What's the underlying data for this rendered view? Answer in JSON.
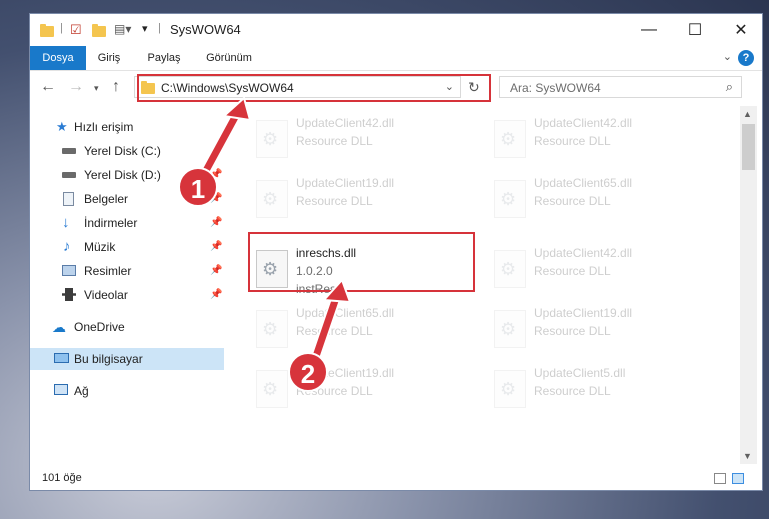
{
  "window": {
    "title": "SysWOW64",
    "controls": [
      "—",
      "☐",
      "✕"
    ]
  },
  "ribbon": {
    "tabs": [
      "Dosya",
      "Giriş",
      "Paylaş",
      "Görünüm"
    ],
    "help": "?"
  },
  "address": {
    "path": "C:\\Windows\\SysWOW64",
    "search_placeholder": "Ara: SysWOW64"
  },
  "sidebar": {
    "items": [
      {
        "label": "Hızlı erişim",
        "icon": "star-icon",
        "pinned": false
      },
      {
        "label": "Yerel Disk (C:)",
        "icon": "disk-icon",
        "pinned": true
      },
      {
        "label": "Yerel Disk (D:)",
        "icon": "disk-icon",
        "pinned": true
      },
      {
        "label": "Belgeler",
        "icon": "documents-icon",
        "pinned": true
      },
      {
        "label": "İndirmeler",
        "icon": "download-icon",
        "pinned": true
      },
      {
        "label": "Müzik",
        "icon": "music-icon",
        "pinned": true
      },
      {
        "label": "Resimler",
        "icon": "pictures-icon",
        "pinned": true
      },
      {
        "label": "Videolar",
        "icon": "videos-icon",
        "pinned": true
      },
      {
        "label": "OneDrive",
        "icon": "cloud-icon",
        "pinned": false
      },
      {
        "label": "Bu bilgisayar",
        "icon": "computer-icon",
        "pinned": false
      },
      {
        "label": "Ağ",
        "icon": "network-icon",
        "pinned": false
      }
    ]
  },
  "files": {
    "left": [
      {
        "name": "UpdateClient42.dll",
        "sub": "Resource DLL"
      },
      {
        "name": "UpdateClient19.dll",
        "sub": "Resource DLL"
      },
      {
        "name": "inreschs.dll",
        "sub": "1.0.2.0",
        "sub2": "instRes"
      },
      {
        "name": "UpdateClient65.dll",
        "sub": "Resource DLL"
      },
      {
        "name": "UpdateClient19.dll",
        "sub": "Resource DLL"
      }
    ],
    "right": [
      {
        "name": "UpdateClient42.dll",
        "sub": "Resource DLL"
      },
      {
        "name": "UpdateClient65.dll",
        "sub": "Resource DLL"
      },
      {
        "name": "UpdateClient42.dll",
        "sub": "Resource DLL"
      },
      {
        "name": "UpdateClient19.dll",
        "sub": "Resource DLL"
      },
      {
        "name": "UpdateClient5.dll",
        "sub": "Resource DLL"
      }
    ]
  },
  "status": {
    "count": "101 öğe"
  },
  "annotations": {
    "step1": "1",
    "step2": "2"
  },
  "colors": {
    "accent": "#1979ca",
    "annotation": "#d6333a",
    "selected": "#cce4f7"
  }
}
